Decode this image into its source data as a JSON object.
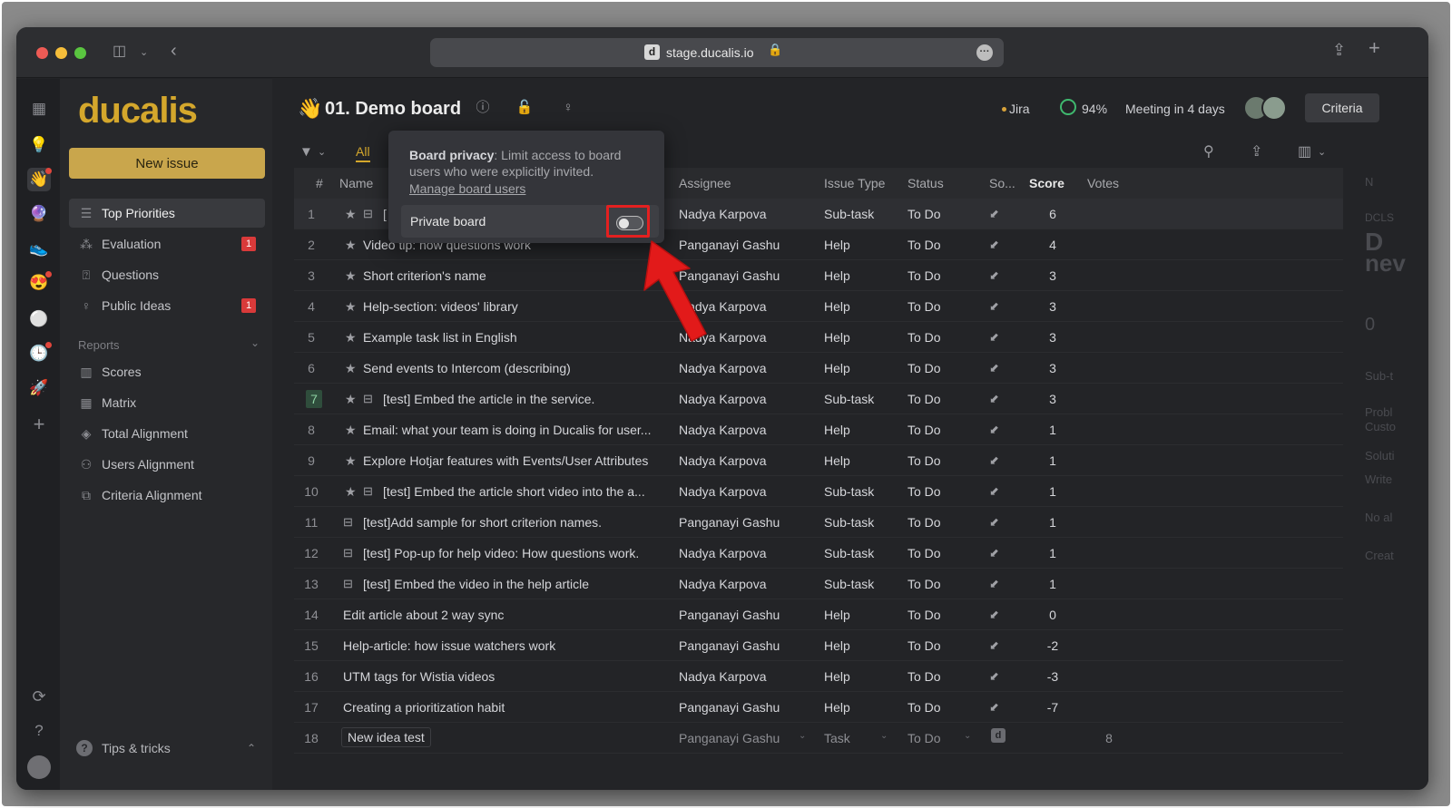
{
  "browser": {
    "url": "stage.ducalis.io",
    "favicon": "d"
  },
  "sidebar": {
    "logo": "ducalis",
    "new_issue": "New issue",
    "items": [
      {
        "label": "Top Priorities",
        "icon": "list-icon"
      },
      {
        "label": "Evaluation",
        "icon": "nodes-icon",
        "badge": "1"
      },
      {
        "label": "Questions",
        "icon": "question-box-icon"
      },
      {
        "label": "Public Ideas",
        "icon": "bulb-icon",
        "badge": "1"
      }
    ],
    "reports_heading": "Reports",
    "reports": [
      {
        "label": "Scores",
        "icon": "columns-icon"
      },
      {
        "label": "Matrix",
        "icon": "grid-icon"
      },
      {
        "label": "Total Alignment",
        "icon": "layers-icon"
      },
      {
        "label": "Users Alignment",
        "icon": "users-icon"
      },
      {
        "label": "Criteria Alignment",
        "icon": "copy-icon"
      }
    ],
    "tips": "Tips & tricks"
  },
  "header": {
    "emoji": "👋",
    "title": "01. Demo board",
    "jira": "Jira",
    "progress": "94%",
    "meeting": "Meeting in 4 days",
    "criteria_button": "Criteria"
  },
  "toolbar": {
    "tab_all": "All"
  },
  "table": {
    "columns": {
      "num": "#",
      "name": "Name",
      "assignee": "Assignee",
      "type": "Issue Type",
      "status": "Status",
      "source": "So...",
      "score": "Score",
      "votes": "Votes"
    },
    "rows": [
      {
        "n": "1",
        "name": "[",
        "star": true,
        "sub": true,
        "assignee": "Nadya Karpova",
        "type": "Sub-task",
        "status": "To Do",
        "score": "6"
      },
      {
        "n": "2",
        "name": "Video tip: how questions work",
        "star": true,
        "sub": false,
        "assignee": "Panganayi Gashu",
        "type": "Help",
        "status": "To Do",
        "score": "4"
      },
      {
        "n": "3",
        "name": "Short criterion's name",
        "star": true,
        "sub": false,
        "assignee": "Panganayi Gashu",
        "type": "Help",
        "status": "To Do",
        "score": "3"
      },
      {
        "n": "4",
        "name": "Help-section: videos' library",
        "star": true,
        "sub": false,
        "assignee": "Nadya Karpova",
        "type": "Help",
        "status": "To Do",
        "score": "3"
      },
      {
        "n": "5",
        "name": "Example task list in English",
        "star": true,
        "sub": false,
        "assignee": "Nadya Karpova",
        "type": "Help",
        "status": "To Do",
        "score": "3"
      },
      {
        "n": "6",
        "name": "Send events to Intercom (describing)",
        "star": true,
        "sub": false,
        "assignee": "Nadya Karpova",
        "type": "Help",
        "status": "To Do",
        "score": "3"
      },
      {
        "n": "7",
        "name": "[test] Embed the article in the service.",
        "star": true,
        "sub": true,
        "assignee": "Nadya Karpova",
        "type": "Sub-task",
        "status": "To Do",
        "score": "3",
        "boxed": true
      },
      {
        "n": "8",
        "name": "Email: what your team is doing in Ducalis for user...",
        "star": true,
        "sub": false,
        "assignee": "Nadya Karpova",
        "type": "Help",
        "status": "To Do",
        "score": "1"
      },
      {
        "n": "9",
        "name": "Explore Hotjar features with Events/User Attributes",
        "star": true,
        "sub": false,
        "assignee": "Nadya Karpova",
        "type": "Help",
        "status": "To Do",
        "score": "1"
      },
      {
        "n": "10",
        "name": "[test] Embed the article short video into the a...",
        "star": true,
        "sub": true,
        "assignee": "Nadya Karpova",
        "type": "Sub-task",
        "status": "To Do",
        "score": "1"
      },
      {
        "n": "11",
        "name": "[test]Add sample for short criterion names.",
        "star": false,
        "sub": true,
        "assignee": "Panganayi Gashu",
        "type": "Sub-task",
        "status": "To Do",
        "score": "1"
      },
      {
        "n": "12",
        "name": "[test] Pop-up for help video: How questions work.",
        "star": false,
        "sub": true,
        "assignee": "Nadya Karpova",
        "type": "Sub-task",
        "status": "To Do",
        "score": "1"
      },
      {
        "n": "13",
        "name": "[test] Embed the video in the help article",
        "star": false,
        "sub": true,
        "assignee": "Nadya Karpova",
        "type": "Sub-task",
        "status": "To Do",
        "score": "1"
      },
      {
        "n": "14",
        "name": "Edit article about 2 way sync",
        "star": false,
        "sub": false,
        "assignee": "Panganayi Gashu",
        "type": "Help",
        "status": "To Do",
        "score": "0"
      },
      {
        "n": "15",
        "name": "Help-article: how issue watchers work",
        "star": false,
        "sub": false,
        "assignee": "Panganayi Gashu",
        "type": "Help",
        "status": "To Do",
        "score": "-2"
      },
      {
        "n": "16",
        "name": "UTM tags for Wistia videos",
        "star": false,
        "sub": false,
        "assignee": "Nadya Karpova",
        "type": "Help",
        "status": "To Do",
        "score": "-3"
      },
      {
        "n": "17",
        "name": "Creating a prioritization habit",
        "star": false,
        "sub": false,
        "assignee": "Panganayi Gashu",
        "type": "Help",
        "status": "To Do",
        "score": "-7"
      }
    ],
    "new_row": {
      "n": "18",
      "name": "New idea test",
      "assignee": "Panganayi Gashu",
      "type": "Task",
      "status": "To Do",
      "source": "d",
      "votes": "8"
    }
  },
  "popover": {
    "title": "Board privacy",
    "description": ": Limit access to board users who were explicitly invited.",
    "link": "Manage board users",
    "toggle_label": "Private board",
    "toggle_on": false
  },
  "right_panel": [
    "N",
    "DCLS",
    "D",
    "nev",
    "0",
    "Sub-t",
    "Probl",
    "Custo",
    "Soluti",
    "Write",
    "No al",
    "Creat"
  ],
  "colors": {
    "accent": "#d4a72c",
    "new_issue_bg": "#c9a64c",
    "badge": "#d93a3a",
    "highlight": "#e32020",
    "progress": "#3fb86e"
  }
}
